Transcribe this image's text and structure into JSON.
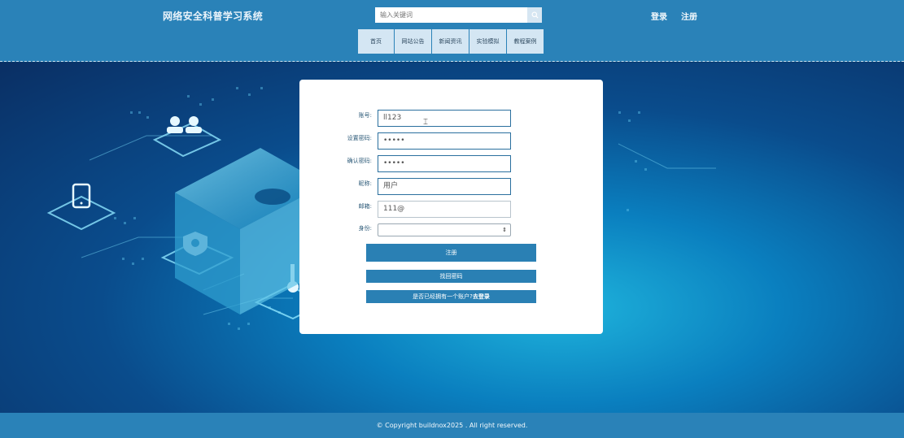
{
  "header": {
    "site_title": "网络安全科普学习系统",
    "search": {
      "placeholder": "输入关键词",
      "icon": "search-icon"
    },
    "login_label": "登录",
    "register_label": "注册"
  },
  "nav": {
    "items": [
      {
        "label": "首页"
      },
      {
        "label": "网站公告"
      },
      {
        "label": "新闻资讯"
      },
      {
        "label": "实验模拟"
      },
      {
        "label": "教程案例"
      }
    ]
  },
  "form": {
    "account": {
      "label": "账号:",
      "value": "ll123"
    },
    "password": {
      "label": "设置密码:",
      "value": "•••••"
    },
    "confirm_password": {
      "label": "确认密码:",
      "value": "•••••"
    },
    "nickname": {
      "label": "昵称:",
      "value": "用户"
    },
    "email": {
      "label": "邮箱:",
      "value": "111@"
    },
    "identity": {
      "label": "身份:",
      "value": "",
      "arrow": "⇕"
    },
    "register_button": "注册",
    "forgot_button": "找回密码",
    "login_prompt": "是否已经拥有一个账户?",
    "login_link": "去登录"
  },
  "footer": {
    "copyright": "© Copyright buildnox2025 . All right reserved."
  },
  "colors": {
    "header_bg": "#2a82b8",
    "nav_bg": "#d4e6f3",
    "button_bg": "#2a80b4",
    "field_border": "#2a6f9e"
  }
}
